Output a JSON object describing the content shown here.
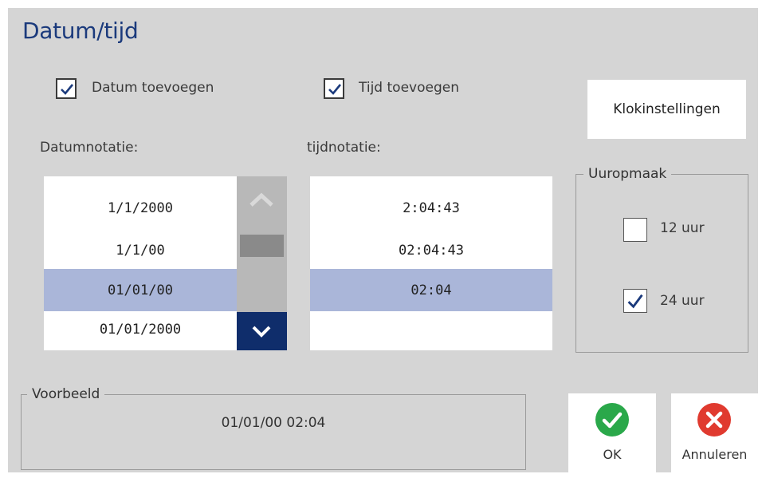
{
  "title": "Datum/tijd",
  "checkboxes": {
    "add_date": {
      "label": "Datum toevoegen",
      "checked": true
    },
    "add_time": {
      "label": "Tijd toevoegen",
      "checked": true
    }
  },
  "clock_settings_label": "Klokinstellingen",
  "date_format": {
    "label": "Datumnotatie:",
    "items": [
      "1/1/2000",
      "1/1/00",
      "01/01/00",
      "01/01/2000"
    ],
    "selected_index": 2
  },
  "time_format": {
    "label": "tijdnotatie:",
    "items": [
      "2:04:43",
      "02:04:43",
      "02:04"
    ],
    "selected_index": 2
  },
  "hour_format": {
    "title": "Uuropmaak",
    "options": [
      {
        "label": "12 uur",
        "checked": false
      },
      {
        "label": "24 uur",
        "checked": true
      }
    ]
  },
  "preview": {
    "title": "Voorbeeld",
    "value": "01/01/00 02:04"
  },
  "actions": {
    "ok_label": "OK",
    "cancel_label": "Annuleren"
  },
  "colors": {
    "title": "#1b3a7c",
    "selection": "#aab6d9",
    "scroll_down_bg": "#0f2d6b",
    "ok_green": "#2aa84a",
    "cancel_red": "#e03a2f"
  }
}
